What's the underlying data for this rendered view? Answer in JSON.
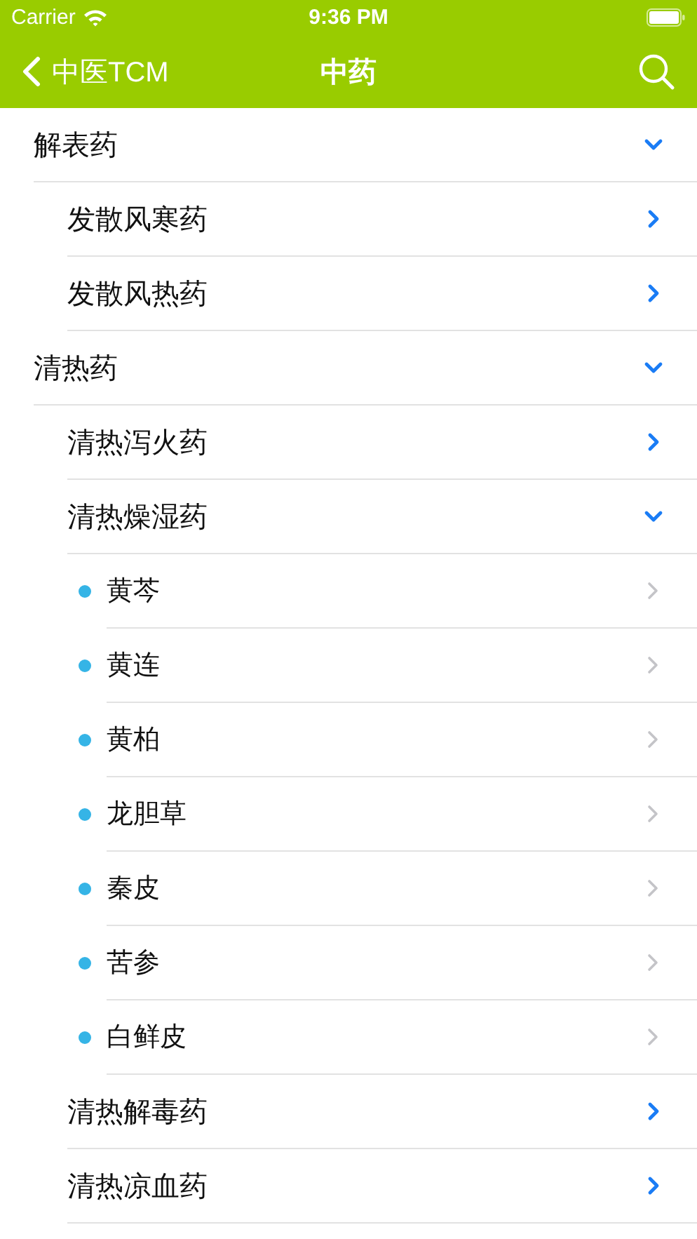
{
  "status_bar": {
    "carrier": "Carrier",
    "time": "9:36 PM"
  },
  "nav_bar": {
    "back_label": "中医TCM",
    "title": "中药"
  },
  "tree": [
    {
      "kind": "category",
      "label": "解表药",
      "expanded": true,
      "children": [
        {
          "kind": "category",
          "label": "发散风寒药",
          "expanded": false
        },
        {
          "kind": "category",
          "label": "发散风热药",
          "expanded": false
        }
      ]
    },
    {
      "kind": "category",
      "label": "清热药",
      "expanded": true,
      "children": [
        {
          "kind": "category",
          "label": "清热泻火药",
          "expanded": false
        },
        {
          "kind": "category",
          "label": "清热燥湿药",
          "expanded": true,
          "children": [
            {
              "kind": "herb",
              "label": "黄芩"
            },
            {
              "kind": "herb",
              "label": "黄连"
            },
            {
              "kind": "herb",
              "label": "黄柏"
            },
            {
              "kind": "herb",
              "label": "龙胆草"
            },
            {
              "kind": "herb",
              "label": "秦皮"
            },
            {
              "kind": "herb",
              "label": "苦参"
            },
            {
              "kind": "herb",
              "label": "白鲜皮"
            }
          ]
        },
        {
          "kind": "category",
          "label": "清热解毒药",
          "expanded": false
        },
        {
          "kind": "category",
          "label": "清热凉血药",
          "expanded": false
        }
      ]
    }
  ]
}
